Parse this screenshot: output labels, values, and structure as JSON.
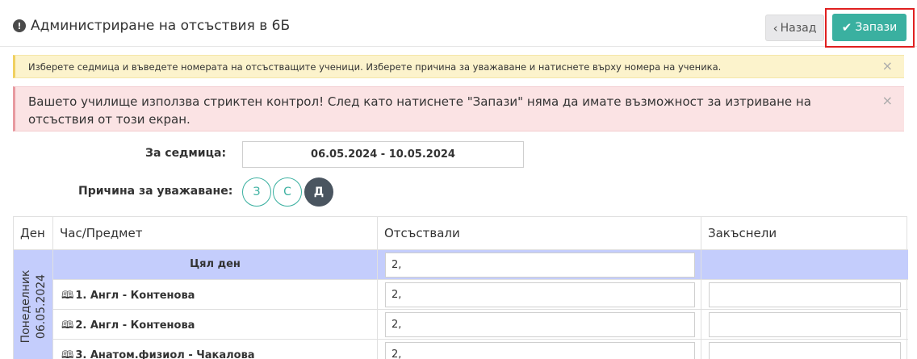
{
  "header": {
    "title": "Администриране на отсъствия в 6Б",
    "back_label": "Назад",
    "save_label": "Запази"
  },
  "alerts": {
    "info": "Изберете седмица и въведете номерата на отсъстващите ученици. Изберете причина за уважаване и натиснете върху номера на ученика.",
    "warning": "Вашето училище използва стриктен контрол! След като натиснете \"Запази\" няма да имате възможност за изтриване на отсъствия от този екран.",
    "close_symbol": "×"
  },
  "form": {
    "week_label": "За седмица:",
    "week_value": "06.05.2024 - 10.05.2024",
    "reason_label": "Причина за уважаване:",
    "reasons": [
      "З",
      "С",
      "Д"
    ],
    "selected_reason": "Д"
  },
  "table": {
    "headers": [
      "Ден",
      "Час/Предмет",
      "Отсъствали",
      "Закъснели"
    ],
    "day": {
      "name": "Понеделник",
      "date": "06.05.2024"
    },
    "rows": [
      {
        "subject": "Цял ден",
        "absent": "2,",
        "late": ""
      },
      {
        "subject": "1. Англ - Контенова",
        "absent": "2,",
        "late": ""
      },
      {
        "subject": "2. Англ - Контенова",
        "absent": "2,",
        "late": ""
      },
      {
        "subject": "3. Анатом.физиол - Чакалова",
        "absent": "2,",
        "late": ""
      }
    ]
  },
  "colors": {
    "accent": "#3ab0a0",
    "highlight_row": "#c4cdfc",
    "warning_bg": "#fcf3cc",
    "danger_bg": "#fbe3e4",
    "save_outline": "#e02020"
  },
  "icons": {
    "title": "exclamation-circle-icon",
    "back": "chevron-left-icon",
    "save": "check-icon",
    "subject": "book-icon"
  }
}
